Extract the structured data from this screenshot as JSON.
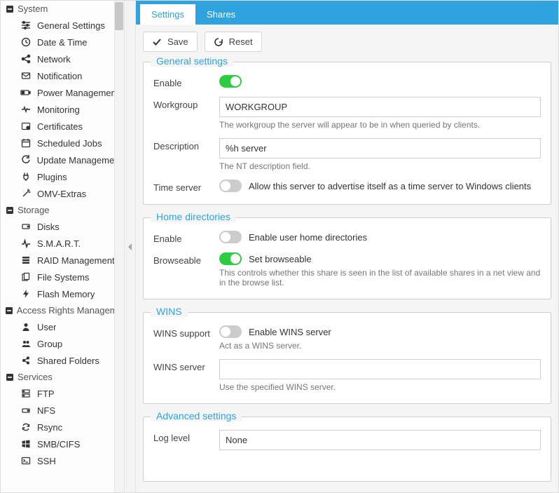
{
  "sidebar": {
    "groups": [
      {
        "label": "System",
        "items": [
          {
            "label": "General Settings",
            "icon": "sliders"
          },
          {
            "label": "Date & Time",
            "icon": "clock"
          },
          {
            "label": "Network",
            "icon": "share"
          },
          {
            "label": "Notification",
            "icon": "mail"
          },
          {
            "label": "Power Management",
            "icon": "battery"
          },
          {
            "label": "Monitoring",
            "icon": "heartbeat"
          },
          {
            "label": "Certificates",
            "icon": "cert"
          },
          {
            "label": "Scheduled Jobs",
            "icon": "calendar"
          },
          {
            "label": "Update Management",
            "icon": "refresh"
          },
          {
            "label": "Plugins",
            "icon": "plug"
          },
          {
            "label": "OMV-Extras",
            "icon": "wand"
          }
        ]
      },
      {
        "label": "Storage",
        "items": [
          {
            "label": "Disks",
            "icon": "hdd"
          },
          {
            "label": "S.M.A.R.T.",
            "icon": "pulse"
          },
          {
            "label": "RAID Management",
            "icon": "raid"
          },
          {
            "label": "File Systems",
            "icon": "files"
          },
          {
            "label": "Flash Memory",
            "icon": "flash"
          }
        ]
      },
      {
        "label": "Access Rights Management",
        "items": [
          {
            "label": "User",
            "icon": "user"
          },
          {
            "label": "Group",
            "icon": "group"
          },
          {
            "label": "Shared Folders",
            "icon": "share-folder"
          }
        ]
      },
      {
        "label": "Services",
        "items": [
          {
            "label": "FTP",
            "icon": "server"
          },
          {
            "label": "NFS",
            "icon": "drive"
          },
          {
            "label": "Rsync",
            "icon": "rsync"
          },
          {
            "label": "SMB/CIFS",
            "icon": "windows"
          },
          {
            "label": "SSH",
            "icon": "terminal"
          }
        ]
      }
    ]
  },
  "tabs": {
    "settings": "Settings",
    "shares": "Shares"
  },
  "buttons": {
    "save": "Save",
    "reset": "Reset"
  },
  "sections": {
    "general": {
      "title": "General settings",
      "enable_label": "Enable",
      "enable_on": true,
      "workgroup_label": "Workgroup",
      "workgroup_value": "WORKGROUP",
      "workgroup_help": "The workgroup the server will appear to be in when queried by clients.",
      "description_label": "Description",
      "description_value": "%h server",
      "description_help": "The NT description field.",
      "timeserver_label": "Time server",
      "timeserver_on": false,
      "timeserver_text": "Allow this server to advertise itself as a time server to Windows clients"
    },
    "home": {
      "title": "Home directories",
      "enable_label": "Enable",
      "enable_on": false,
      "enable_text": "Enable user home directories",
      "browseable_label": "Browseable",
      "browseable_on": true,
      "browseable_text": "Set browseable",
      "browseable_help": "This controls whether this share is seen in the list of available shares in a net view and in the browse list."
    },
    "wins": {
      "title": "WINS",
      "support_label": "WINS support",
      "support_on": false,
      "support_text": "Enable WINS server",
      "support_help": "Act as a WINS server.",
      "server_label": "WINS server",
      "server_value": "",
      "server_help": "Use the specified WINS server."
    },
    "advanced": {
      "title": "Advanced settings",
      "loglevel_label": "Log level",
      "loglevel_value": "None"
    }
  }
}
